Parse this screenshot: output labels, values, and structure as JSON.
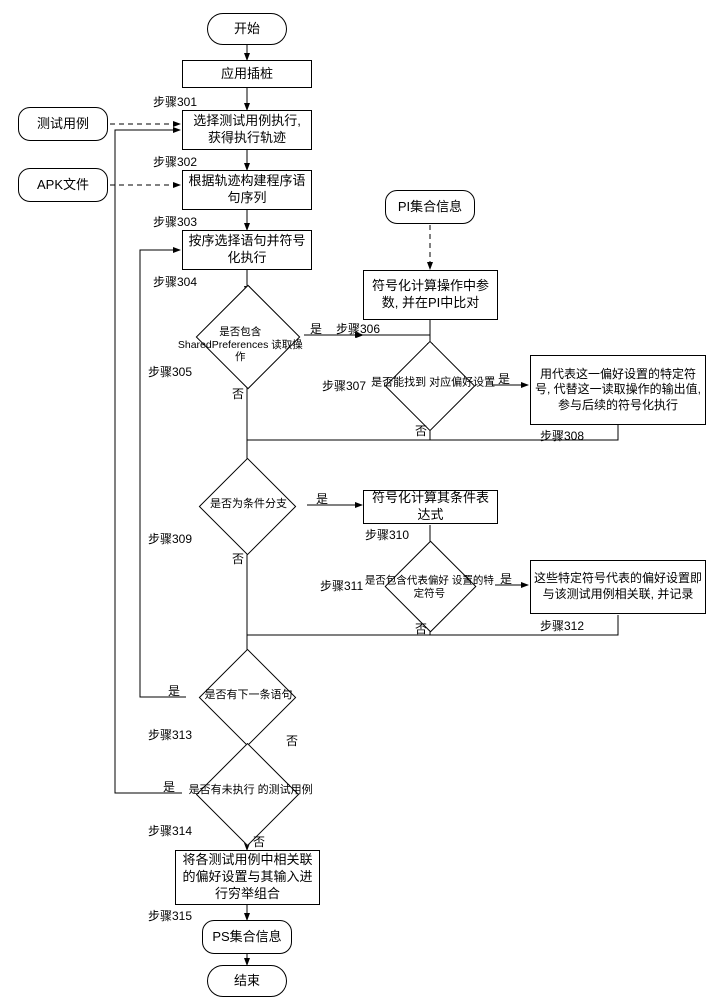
{
  "terminators": {
    "start": "开始",
    "end": "结束"
  },
  "inputs": {
    "test_cases": "测试用例",
    "apk_file": "APK文件",
    "pi_info": "PI集合信息",
    "ps_info": "PS集合信息"
  },
  "processes": {
    "p301": "应用插桩",
    "p302": "选择测试用例执行, 获得执行轨迹",
    "p303": "根据轨迹构建程序语句序列",
    "p304": "按序选择语句并符号化执行",
    "p306": "符号化计算操作中参数, 并在PI中比对",
    "p308": "用代表这一偏好设置的特定符号, 代替这一读取操作的输出值, 参与后续的符号化执行",
    "p310": "符号化计算其条件表达式",
    "p312": "这些特定符号代表的偏好设置即与该测试用例相关联, 并记录",
    "p315": "将各测试用例中相关联的偏好设置与其输入进行穷举组合"
  },
  "decisions": {
    "d305": "是否包含\nSharedPreferences\n读取操作",
    "d307": "是否能找到\n对应偏好设置",
    "d309": "是否为条件分支",
    "d311": "是否包含代表偏好\n设置的特定符号",
    "d313": "是否有下一条语句",
    "d314": "是否有未执行\n的测试用例"
  },
  "step_labels": {
    "s301": "步骤301",
    "s302": "步骤302",
    "s303": "步骤303",
    "s304": "步骤304",
    "s305": "步骤305",
    "s306": "步骤306",
    "s307": "步骤307",
    "s308": "步骤308",
    "s309": "步骤309",
    "s310": "步骤310",
    "s311": "步骤311",
    "s312": "步骤312",
    "s313": "步骤313",
    "s314": "步骤314",
    "s315": "步骤315"
  },
  "edge": {
    "yes": "是",
    "no": "否"
  }
}
